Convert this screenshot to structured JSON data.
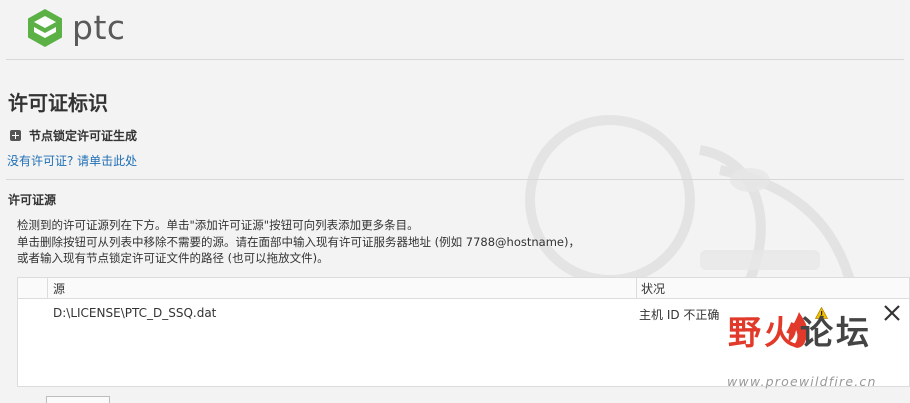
{
  "brand": {
    "logo_text": "ptc",
    "logo_color": "#5bb146"
  },
  "page": {
    "title": "许可证标识"
  },
  "node_locked": {
    "label": "节点锁定许可证生成"
  },
  "no_license_link": "没有许可证? 请单击此处",
  "license_sources": {
    "title": "许可证源",
    "description": [
      "检测到的许可证源列在下方。单击\"添加许可证源\"按钮可向列表添加更多条目。",
      "单击删除按钮可从列表中移除不需要的源。请在面部中输入现有许可证服务器地址 (例如 7788@hostname)，",
      "或者输入现有节点锁定许可证文件的路径 (也可以拖放文件)。"
    ]
  },
  "table": {
    "columns": [
      "源",
      "状况"
    ],
    "rows": [
      {
        "source": "D:\\LICENSE\\PTC_D_SSQ.dat",
        "status": "主机 ID 不正确",
        "status_icon": "warning-icon",
        "remove_icon": "close-icon"
      }
    ]
  },
  "watermark": {
    "chinese": "野火论坛",
    "url": "www.proewildfire.cn",
    "color_red": "#e23a2a",
    "color_dark": "#444444"
  },
  "colors": {
    "link": "#1f6fb5",
    "warning": "#f2c200"
  }
}
